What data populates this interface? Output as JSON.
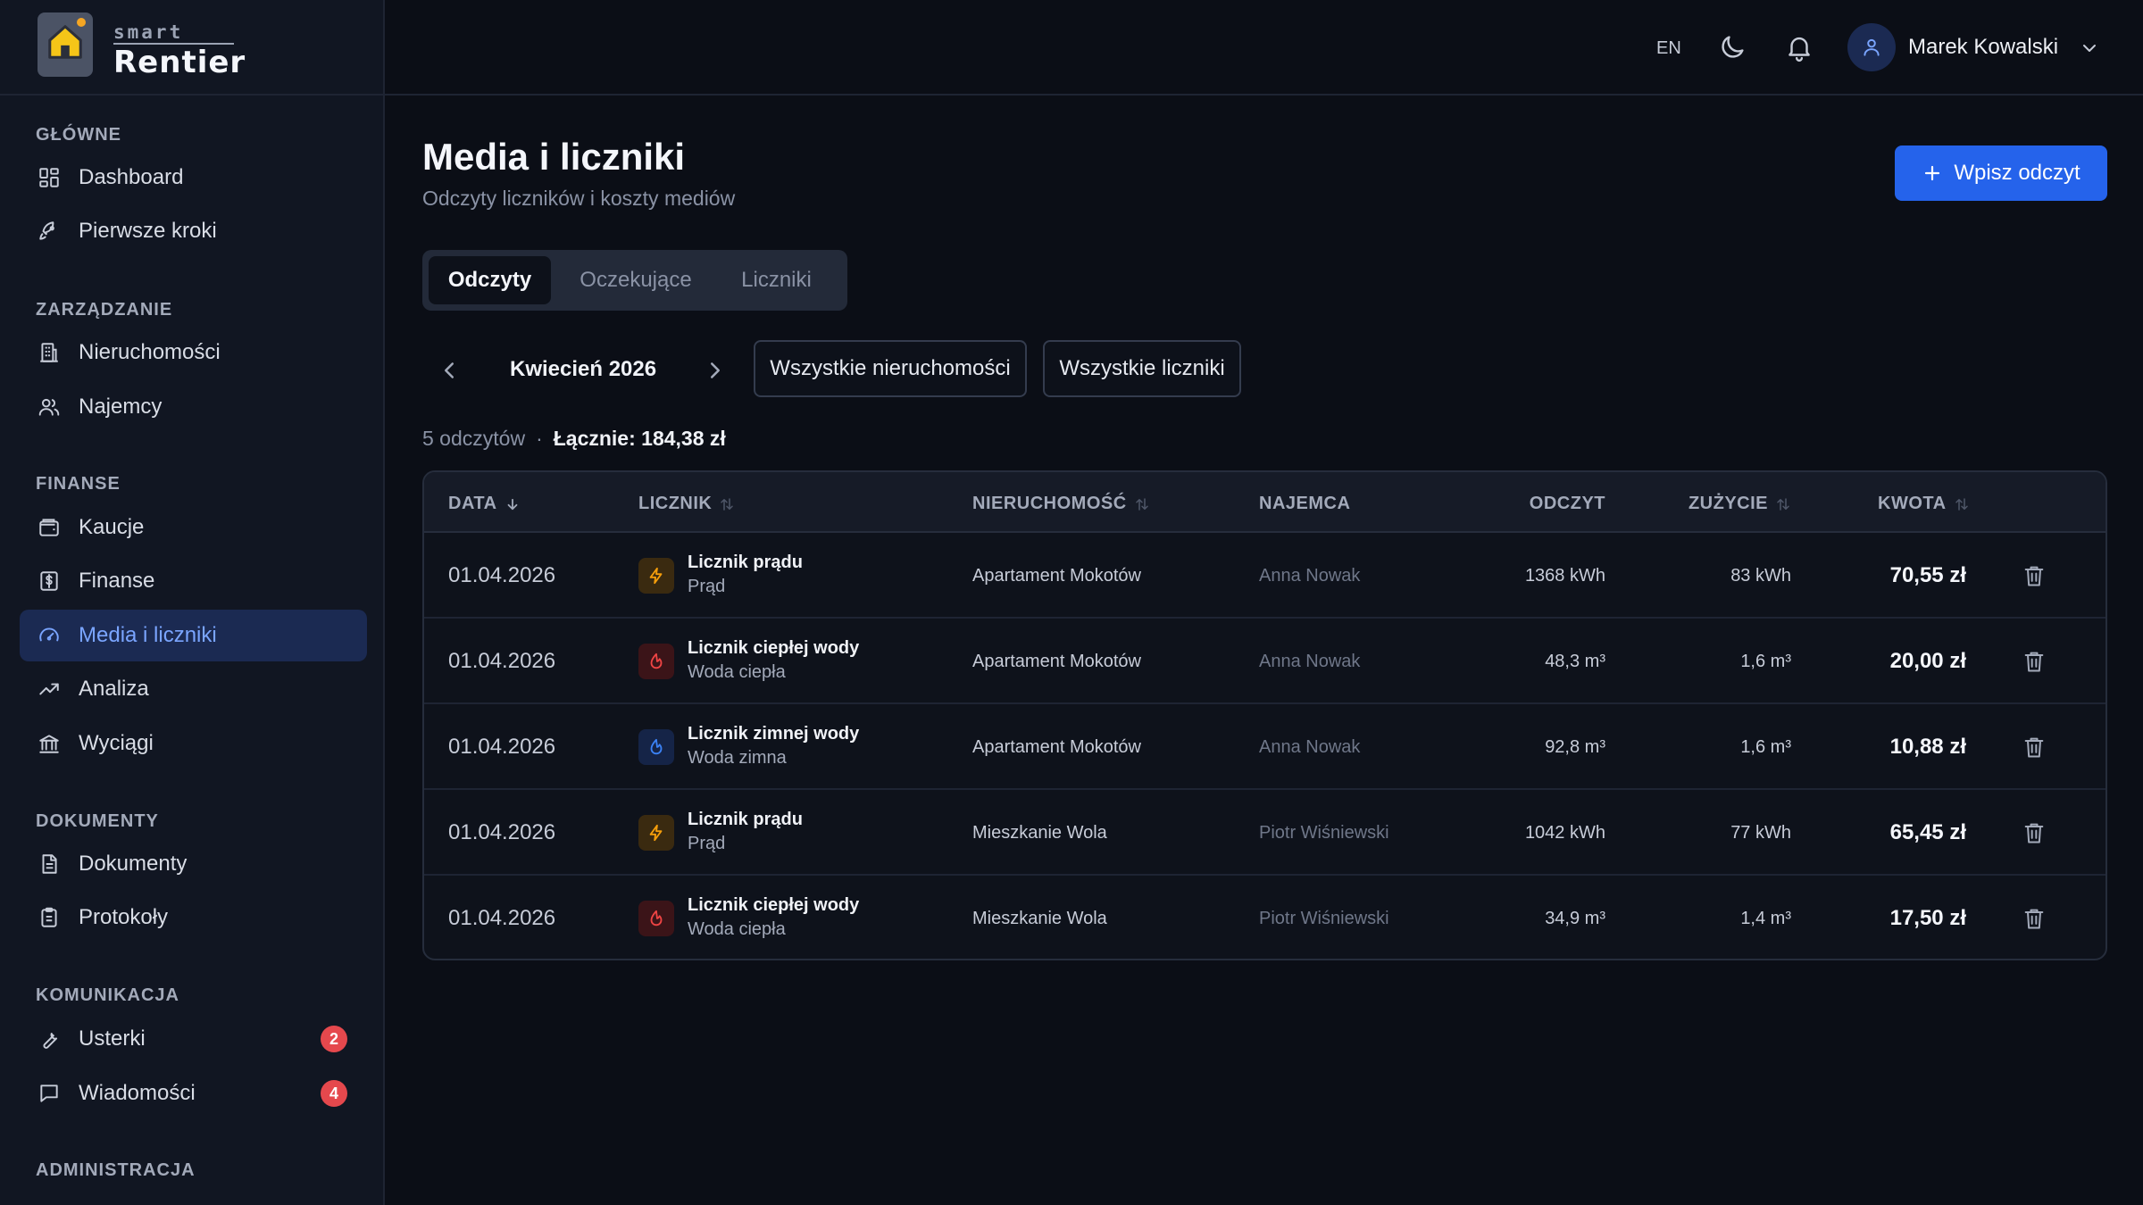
{
  "app": {
    "logo_small": "smart",
    "logo_big": "Rentier"
  },
  "topbar": {
    "lang": "EN",
    "user_name": "Marek Kowalski"
  },
  "sidebar": {
    "sections": [
      {
        "title": "GŁÓWNE",
        "items": [
          {
            "label": "Dashboard",
            "icon": "dashboard-icon"
          },
          {
            "label": "Pierwsze kroki",
            "icon": "rocket-icon"
          }
        ]
      },
      {
        "title": "ZARZĄDZANIE",
        "items": [
          {
            "label": "Nieruchomości",
            "icon": "building-icon"
          },
          {
            "label": "Najemcy",
            "icon": "users-icon"
          }
        ]
      },
      {
        "title": "FINANSE",
        "items": [
          {
            "label": "Kaucje",
            "icon": "wallet-icon"
          },
          {
            "label": "Finanse",
            "icon": "dollar-icon"
          },
          {
            "label": "Media i liczniki",
            "icon": "gauge-icon",
            "active": true
          },
          {
            "label": "Analiza",
            "icon": "trend-icon"
          },
          {
            "label": "Wyciągi",
            "icon": "bank-icon"
          }
        ]
      },
      {
        "title": "DOKUMENTY",
        "items": [
          {
            "label": "Dokumenty",
            "icon": "document-icon"
          },
          {
            "label": "Protokoły",
            "icon": "clipboard-icon"
          }
        ]
      },
      {
        "title": "KOMUNIKACJA",
        "items": [
          {
            "label": "Usterki",
            "icon": "wrench-icon",
            "badge": "2"
          },
          {
            "label": "Wiadomości",
            "icon": "message-icon",
            "badge": "4"
          }
        ]
      },
      {
        "title": "ADMINISTRACJA",
        "items": []
      }
    ]
  },
  "main": {
    "title": "Media i liczniki",
    "subtitle": "Odczyty liczników i koszty mediów",
    "add_button": "Wpisz odczyt",
    "tabs": [
      "Odczyty",
      "Oczekujące",
      "Liczniki"
    ],
    "month": "Kwiecień 2026",
    "filters": {
      "properties": "Wszystkie nieruchomości",
      "meters": "Wszystkie liczniki"
    },
    "summary": {
      "count": "5 odczytów",
      "separator": "·",
      "total": "Łącznie: 184,38 zł"
    }
  },
  "table": {
    "headers": {
      "date": "DATA",
      "meter": "LICZNIK",
      "property": "NIERUCHOMOŚĆ",
      "tenant": "NAJEMCA",
      "reading": "ODCZYT",
      "usage": "ZUŻYCIE",
      "amount": "KWOTA"
    },
    "rows": [
      {
        "date": "01.04.2026",
        "meter": "Licznik prądu",
        "type": "Prąd",
        "kind": "electric",
        "property": "Apartament Mokotów",
        "tenant": "Anna Nowak",
        "reading": "1368 kWh",
        "usage": "83 kWh",
        "amount": "70,55 zł"
      },
      {
        "date": "01.04.2026",
        "meter": "Licznik ciepłej wody",
        "type": "Woda ciepła",
        "kind": "hot",
        "property": "Apartament Mokotów",
        "tenant": "Anna Nowak",
        "reading": "48,3 m³",
        "usage": "1,6 m³",
        "amount": "20,00 zł"
      },
      {
        "date": "01.04.2026",
        "meter": "Licznik zimnej wody",
        "type": "Woda zimna",
        "kind": "cold",
        "property": "Apartament Mokotów",
        "tenant": "Anna Nowak",
        "reading": "92,8 m³",
        "usage": "1,6 m³",
        "amount": "10,88 zł"
      },
      {
        "date": "01.04.2026",
        "meter": "Licznik prądu",
        "type": "Prąd",
        "kind": "electric",
        "property": "Mieszkanie Wola",
        "tenant": "Piotr Wiśniewski",
        "reading": "1042 kWh",
        "usage": "77 kWh",
        "amount": "65,45 zł"
      },
      {
        "date": "01.04.2026",
        "meter": "Licznik ciepłej wody",
        "type": "Woda ciepła",
        "kind": "hot",
        "property": "Mieszkanie Wola",
        "tenant": "Piotr Wiśniewski",
        "reading": "34,9 m³",
        "usage": "1,4 m³",
        "amount": "17,50 zł"
      }
    ]
  },
  "colors": {
    "accent": "#2563eb",
    "active_nav_bg": "#1b2a52",
    "badge": "#e5484d",
    "electric": "#f59e0b",
    "hot_water": "#ef4444",
    "cold_water": "#3b82f6"
  }
}
